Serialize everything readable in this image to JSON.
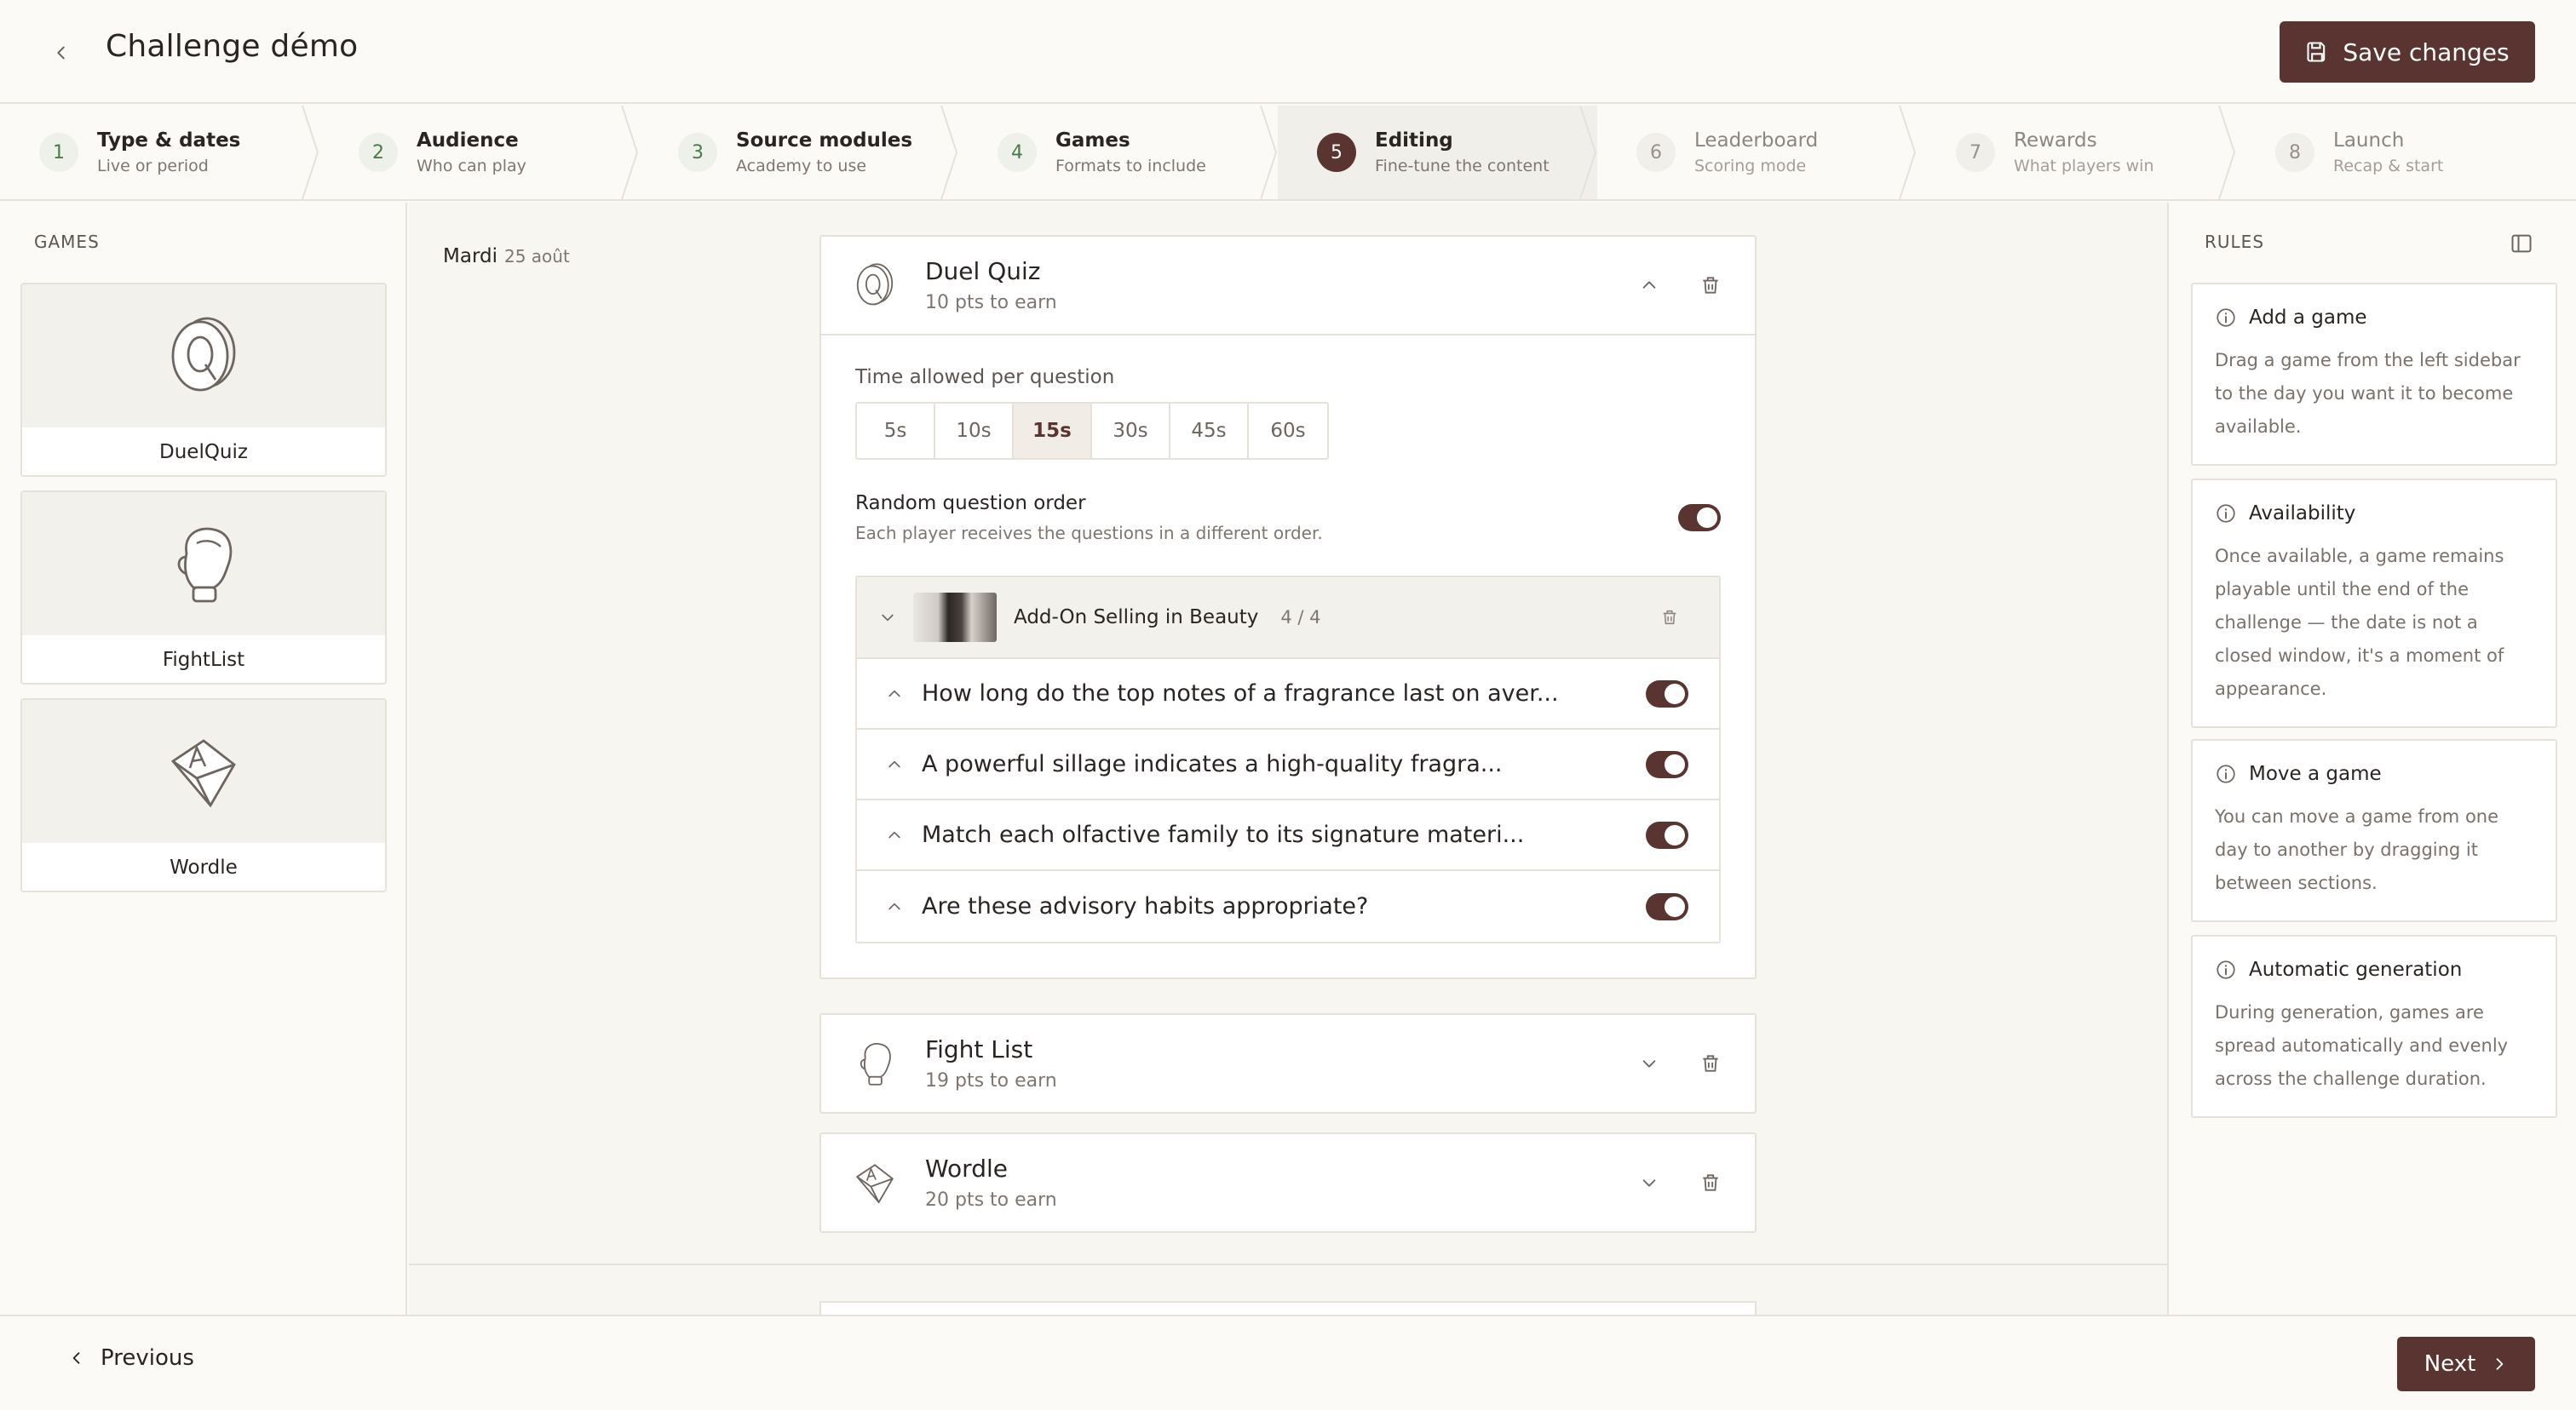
{
  "header": {
    "title": "Challenge démo",
    "save_label": "Save changes"
  },
  "steps": [
    {
      "num": "1",
      "title": "Type & dates",
      "sub": "Live or period"
    },
    {
      "num": "2",
      "title": "Audience",
      "sub": "Who can play"
    },
    {
      "num": "3",
      "title": "Source modules",
      "sub": "Academy to use"
    },
    {
      "num": "4",
      "title": "Games",
      "sub": "Formats to include"
    },
    {
      "num": "5",
      "title": "Editing",
      "sub": "Fine-tune the content"
    },
    {
      "num": "6",
      "title": "Leaderboard",
      "sub": "Scoring mode"
    },
    {
      "num": "7",
      "title": "Rewards",
      "sub": "What players win"
    },
    {
      "num": "8",
      "title": "Launch",
      "sub": "Recap & start"
    }
  ],
  "left_sidebar": {
    "label": "GAMES",
    "games": [
      {
        "name": "DuelQuiz",
        "icon": "duel-quiz-icon"
      },
      {
        "name": "FightList",
        "icon": "boxing-glove-icon"
      },
      {
        "name": "Wordle",
        "icon": "letter-cube-icon"
      }
    ]
  },
  "main": {
    "day": "Mardi",
    "date": "25 août",
    "panels": [
      {
        "title": "Duel Quiz",
        "sub": "10 pts to earn"
      },
      {
        "title": "Fight List",
        "sub": "19 pts to earn"
      },
      {
        "title": "Wordle",
        "sub": "20 pts to earn"
      }
    ],
    "duel": {
      "time_label": "Time allowed per question",
      "times": [
        "5s",
        "10s",
        "15s",
        "30s",
        "45s",
        "60s"
      ],
      "selected_time": "15s",
      "random_title": "Random question order",
      "random_sub": "Each player receives the questions in a different order.",
      "module_title": "Add-On Selling in Beauty",
      "module_count": "4 / 4",
      "questions": [
        "How long do the top notes of a fragrance last on aver...",
        "A powerful sillage indicates a high-quality fragra...",
        "Match each olfactive family to its signature materi...",
        "Are these advisory habits appropriate?"
      ]
    }
  },
  "right_sidebar": {
    "label": "RULES",
    "rules": [
      {
        "title": "Add a game",
        "text": "Drag a game from the left sidebar to the day you want it to become available."
      },
      {
        "title": "Availability",
        "text": "Once available, a game remains playable until the end of the challenge — the date is not a closed window, it's a moment of appearance."
      },
      {
        "title": "Move a game",
        "text": "You can move a game from one day to another by dragging it between sections."
      },
      {
        "title": "Automatic generation",
        "text": "During generation, games are spread automatically and evenly across the challenge duration."
      }
    ]
  },
  "footer": {
    "prev_label": "Previous",
    "next_label": "Next"
  },
  "colors": {
    "accent": "#5a3430",
    "border": "#e6e2da",
    "background": "#fbfaf6",
    "done_step": "#4a7a4a"
  }
}
